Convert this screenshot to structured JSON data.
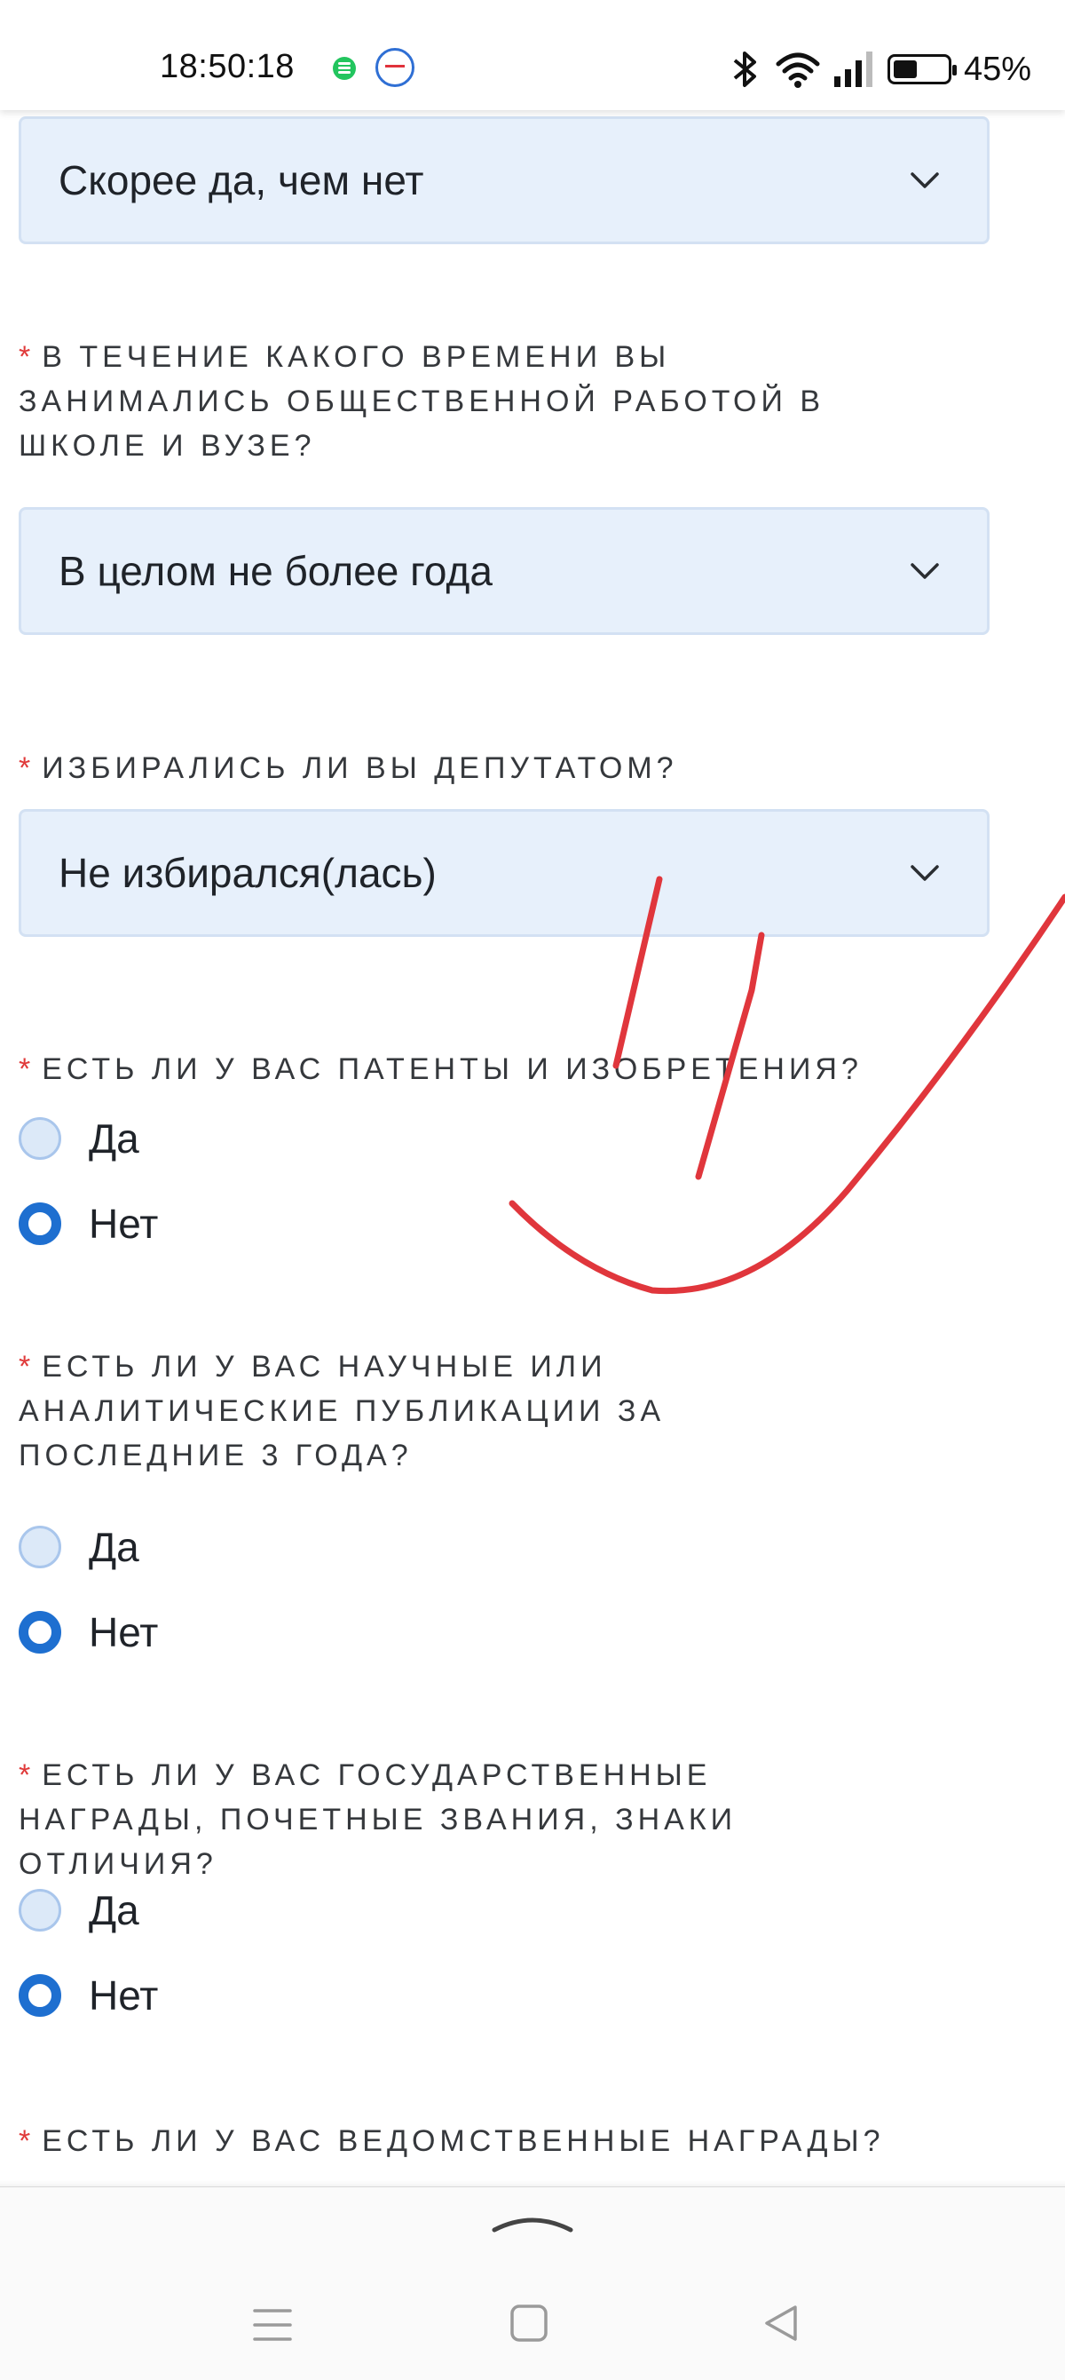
{
  "status_bar": {
    "time": "18:50:18",
    "battery_percent": "45%",
    "battery_level": 0.45,
    "icons": [
      "messages-icon",
      "gosuslugi-icon",
      "bluetooth-icon",
      "wifi-icon",
      "signal-icon",
      "battery-icon"
    ]
  },
  "form": {
    "answer_top": "Скорее да, чем нет",
    "q_public_work": {
      "asterisk": "*",
      "label": "В течение какого времени вы занимались общественной работой в школе и вузе?",
      "selected": "В целом не более года"
    },
    "q_deputy": {
      "asterisk": "*",
      "label": "Избирались ли вы депутатом?",
      "selected": "Не избирался(лась)"
    },
    "q_patents": {
      "asterisk": "*",
      "label": "Есть ли у вас патенты и изобретения?",
      "options": [
        "Да",
        "Нет"
      ],
      "selected": "Нет"
    },
    "q_publications": {
      "asterisk": "*",
      "label": "Есть ли у вас научные или аналитические публикации за последние 3 года?",
      "options": [
        "Да",
        "Нет"
      ],
      "selected": "Нет"
    },
    "q_state_awards": {
      "asterisk": "*",
      "label": "Есть ли у вас государственные награды, почетные звания, знаки отличия?",
      "options": [
        "Да",
        "Нет"
      ],
      "selected": "Нет"
    },
    "q_dept_awards": {
      "asterisk": "*",
      "label": "Есть ли у вас ведомственные награды?"
    }
  },
  "colors": {
    "accent": "#1e6fd0",
    "required": "#e03a3a",
    "field_bg": "#e7f0fb",
    "annotation": "#e0363c"
  }
}
